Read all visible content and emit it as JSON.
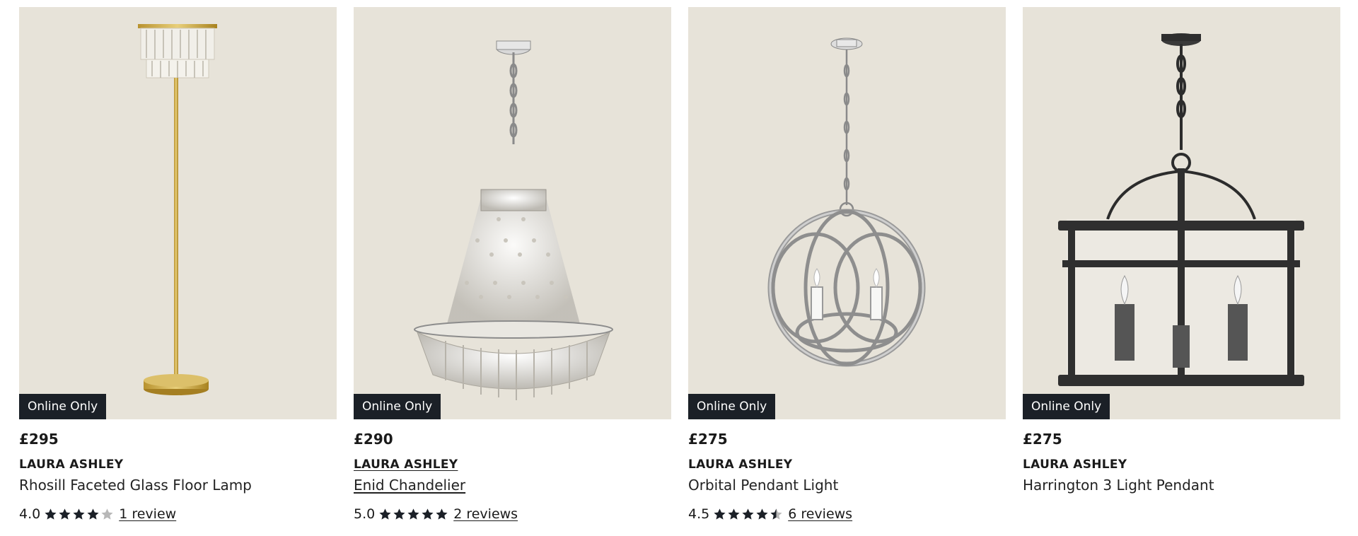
{
  "products": [
    {
      "badge": "Online Only",
      "price": "£295",
      "brand": "LAURA ASHLEY",
      "name": "Rhosill Faceted Glass Floor Lamp",
      "rating_text": "4.0",
      "rating": 4.0,
      "reviews": "1 review",
      "image_icon": "floor-lamp"
    },
    {
      "badge": "Online Only",
      "price": "£290",
      "brand": "LAURA ASHLEY",
      "name": "Enid Chandelier",
      "rating_text": "5.0",
      "rating": 5.0,
      "reviews": "2 reviews",
      "image_icon": "chandelier"
    },
    {
      "badge": "Online Only",
      "price": "£275",
      "brand": "LAURA ASHLEY",
      "name": "Orbital Pendant Light",
      "rating_text": "4.5",
      "rating": 4.5,
      "reviews": "6 reviews",
      "image_icon": "orb-pendant"
    },
    {
      "badge": "Online Only",
      "price": "£275",
      "brand": "LAURA ASHLEY",
      "name": "Harrington 3 Light Pendant",
      "image_icon": "lantern-pendant"
    }
  ],
  "colors": {
    "image_bg": "#e7e3d9",
    "badge_bg": "#1b2027",
    "star_filled": "#1b2027",
    "star_empty": "#b8b8b8"
  }
}
